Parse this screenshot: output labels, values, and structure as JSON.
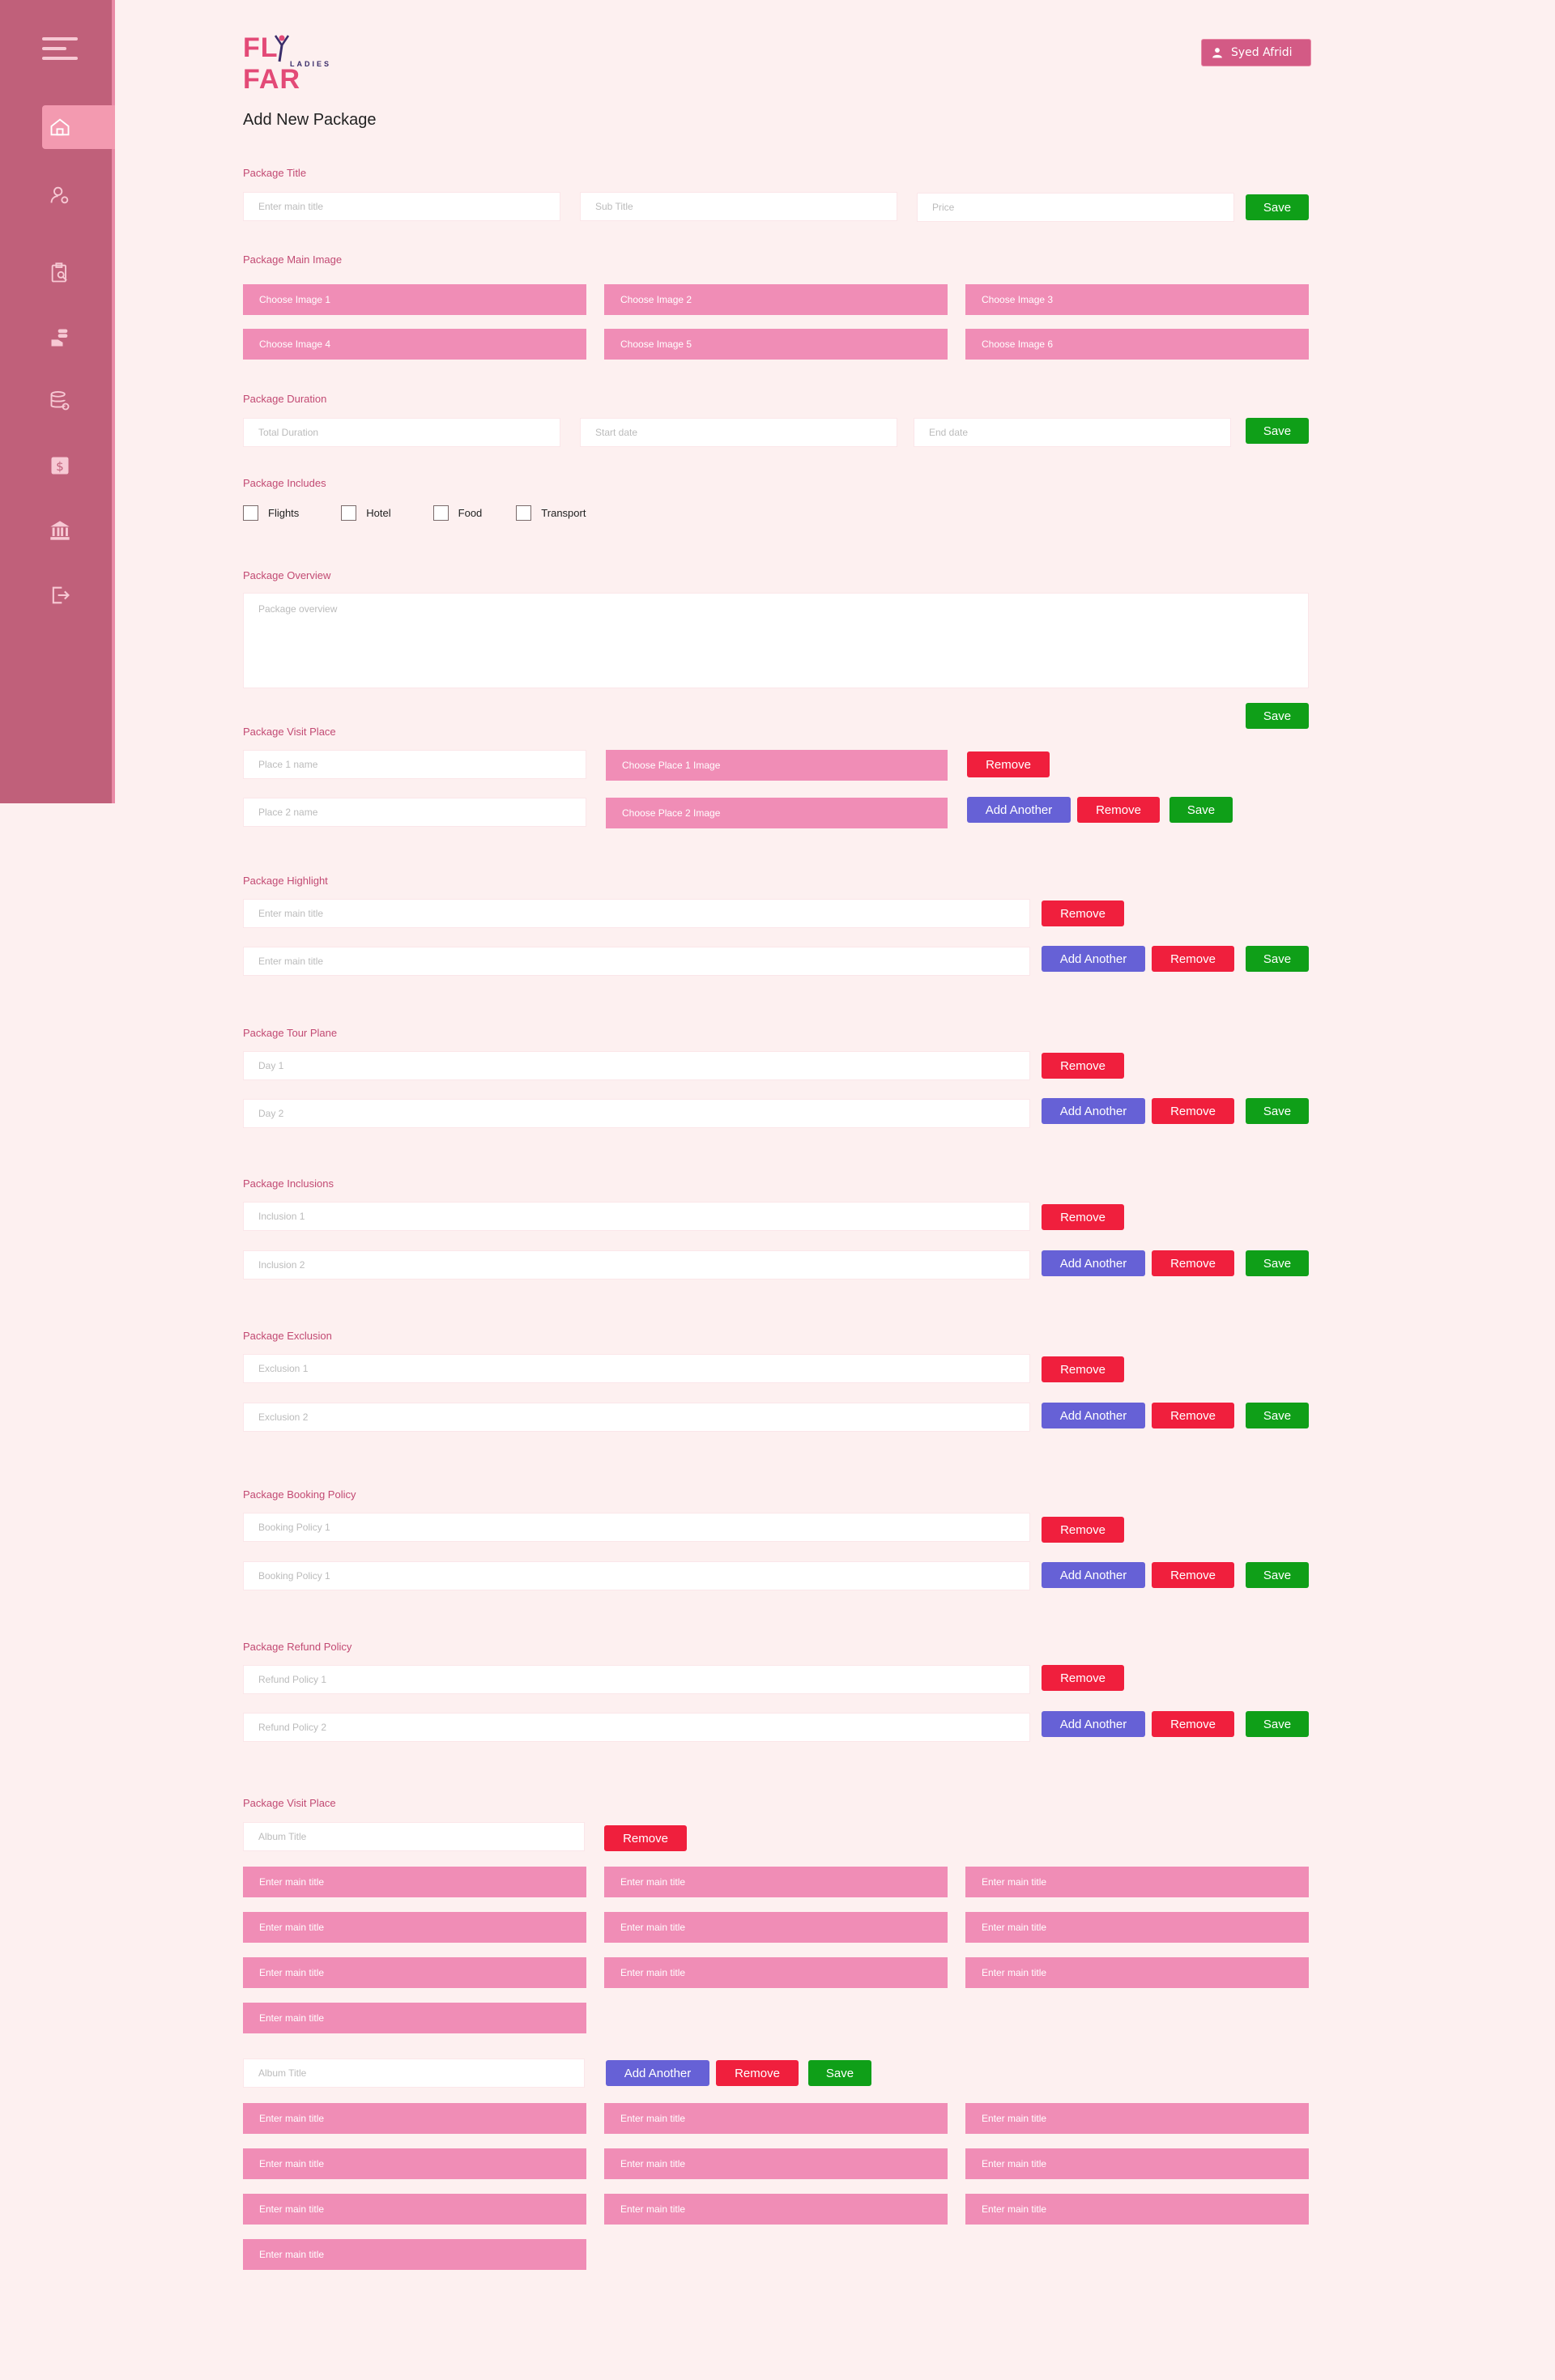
{
  "brand": {
    "logo_text": "FL  FAR",
    "logo_sub": "LADIES"
  },
  "header": {
    "user_name": "Syed Afridi",
    "page_title": "Add New Package"
  },
  "sidebar": {
    "items": [
      {
        "icon": "home-icon",
        "active": true
      },
      {
        "icon": "user-settings-icon",
        "active": false
      },
      {
        "icon": "clipboard-search-icon",
        "active": false
      },
      {
        "icon": "hand-coins-icon",
        "active": false
      },
      {
        "icon": "database-settings-icon",
        "active": false
      },
      {
        "icon": "dollar-icon",
        "active": false
      },
      {
        "icon": "bank-icon",
        "active": false
      },
      {
        "icon": "logout-icon",
        "active": false
      }
    ]
  },
  "buttons": {
    "save": "Save",
    "remove": "Remove",
    "add_another": "Add Another"
  },
  "title_section": {
    "label": "Package Title",
    "main_title_placeholder": "Enter main title",
    "sub_title_placeholder": "Sub Title",
    "price_placeholder": "Price"
  },
  "main_image": {
    "label": "Package Main Image",
    "images": [
      "Choose Image 1",
      "Choose Image 2",
      "Choose Image 3",
      "Choose Image 4",
      "Choose Image 5",
      "Choose Image 6"
    ]
  },
  "duration": {
    "label": "Package Duration",
    "total_placeholder": "Total Duration",
    "start_placeholder": "Start date",
    "end_placeholder": "End date"
  },
  "includes": {
    "label": "Package Includes",
    "options": [
      "Flights",
      "Hotel",
      "Food",
      "Transport"
    ]
  },
  "overview": {
    "label": "Package Overview",
    "placeholder": "Package overview"
  },
  "visit_place": {
    "label": "Package Visit Place",
    "place1_placeholder": "Place 1 name",
    "place1_image": "Choose Place 1 Image",
    "place2_placeholder": "Place 2 name",
    "place2_image": "Choose Place 2 Image"
  },
  "highlight": {
    "label": "Package Highlight",
    "row1": "Enter main title",
    "row2": "Enter main title"
  },
  "tour_plan": {
    "label": "Package Tour Plane",
    "row1": "Day 1",
    "row2": "Day 2"
  },
  "inclusions": {
    "label": "Package Inclusions",
    "row1": "Inclusion 1",
    "row2": "Inclusion 2"
  },
  "exclusion": {
    "label": "Package Exclusion",
    "row1": "Exclusion 1",
    "row2": "Exclusion 2"
  },
  "booking_policy": {
    "label": "Package Booking Policy",
    "row1": "Booking Policy 1",
    "row2": "Booking Policy 1"
  },
  "refund_policy": {
    "label": "Package Refund Policy",
    "row1": "Refund Policy 1",
    "row2": "Refund Policy 2"
  },
  "album": {
    "label": "Package Visit Place",
    "album_title_placeholder": "Album Title",
    "image_field": "Enter main title"
  }
}
